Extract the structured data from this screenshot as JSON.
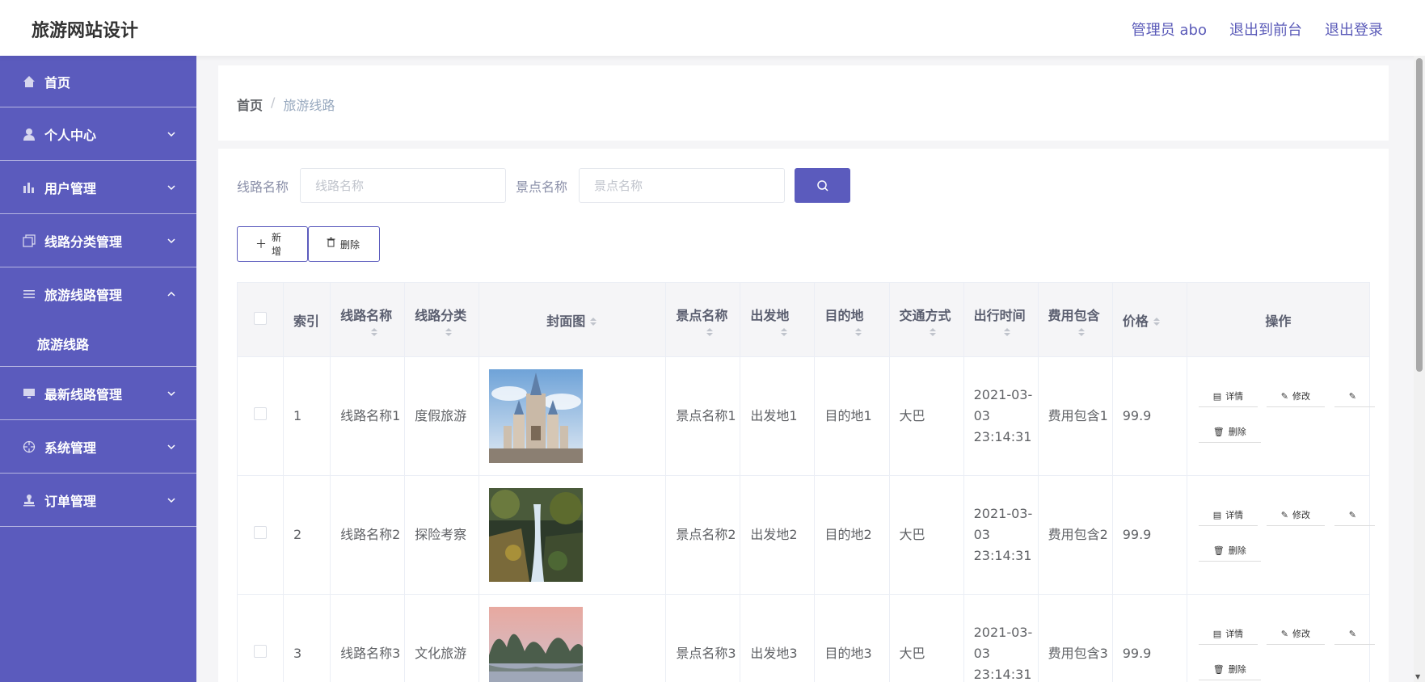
{
  "app": {
    "title": "旅游网站设计"
  },
  "topnav": {
    "admin": "管理员 abo",
    "front": "退出到前台",
    "logout": "退出登录"
  },
  "sidebar": {
    "items": [
      {
        "label": "首页",
        "icon": "home-icon"
      },
      {
        "label": "个人中心",
        "icon": "user-icon"
      },
      {
        "label": "用户管理",
        "icon": "bar-chart-icon"
      },
      {
        "label": "线路分类管理",
        "icon": "copy-icon"
      },
      {
        "label": "旅游线路管理",
        "icon": "menu-icon"
      },
      {
        "label": "最新线路管理",
        "icon": "monitor-icon"
      },
      {
        "label": "系统管理",
        "icon": "crosshair-icon"
      },
      {
        "label": "订单管理",
        "icon": "stamp-icon"
      }
    ],
    "submenu": "旅游线路"
  },
  "breadcrumb": {
    "home": "首页",
    "sep": "/",
    "current": "旅游线路"
  },
  "search": {
    "route_label": "线路名称",
    "route_placeholder": "线路名称",
    "spot_label": "景点名称",
    "spot_placeholder": "景点名称"
  },
  "buttons": {
    "add": "新增",
    "delete": "删除"
  },
  "table": {
    "headers": [
      "索引",
      "线路名称",
      "线路分类",
      "封面图",
      "景点名称",
      "出发地",
      "目的地",
      "交通方式",
      "出行时间",
      "费用包含",
      "价格",
      "操作"
    ],
    "actions": {
      "detail": "详情",
      "edit": "修改",
      "delete": "删除"
    },
    "rows": [
      {
        "index": "1",
        "route": "线路名称1",
        "category": "度假旅游",
        "spot": "景点名称1",
        "from": "出发地1",
        "to": "目的地1",
        "transport": "大巴",
        "time": "2021-03-03 23:14:31",
        "fee": "费用包含1",
        "price": "99.9",
        "image": "castle"
      },
      {
        "index": "2",
        "route": "线路名称2",
        "category": "探险考察",
        "spot": "景点名称2",
        "from": "出发地2",
        "to": "目的地2",
        "transport": "大巴",
        "time": "2021-03-03 23:14:31",
        "fee": "费用包含2",
        "price": "99.9",
        "image": "waterfall"
      },
      {
        "index": "3",
        "route": "线路名称3",
        "category": "文化旅游",
        "spot": "景点名称3",
        "from": "出发地3",
        "to": "目的地3",
        "transport": "大巴",
        "time": "2021-03-03 23:14:31",
        "fee": "费用包含3",
        "price": "99.9",
        "image": "river"
      }
    ]
  },
  "colors": {
    "primary": "#5b5bbd",
    "sidebar": "#5b5bbd",
    "link": "#5a5ab8"
  }
}
